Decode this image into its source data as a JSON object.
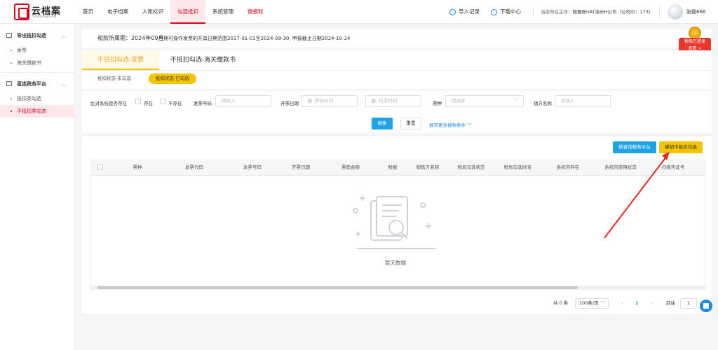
{
  "app": {
    "logo_text": "云档案",
    "logo_sub": "YUNDANGAN"
  },
  "nav": {
    "items": [
      {
        "label": "首页"
      },
      {
        "label": "电子档案"
      },
      {
        "label": "入账标识"
      },
      {
        "label": "勾选抵扣"
      },
      {
        "label": "系统管理"
      },
      {
        "label": "微报账"
      }
    ],
    "active_index": 3
  },
  "topbar": {
    "import_label": "导入记录",
    "download_label": "下载中心",
    "entity_label": "当前所在主体：",
    "entity_value": "微报账UAT演示H公司（公司ID：173）",
    "username": "张磊666"
  },
  "sidebar": {
    "groups": [
      {
        "label": "导出抵扣勾选",
        "items": [
          "发票",
          "海关缴款书"
        ]
      },
      {
        "label": "直连税务平台",
        "items": [
          "抵扣类勾选",
          "不抵扣类勾选"
        ]
      }
    ],
    "active_item": "不抵扣类勾选"
  },
  "header": {
    "tax_period": "税款所属期：2024年09月",
    "range_text": "当期可操作发票的开具日期范围2017-01-01至2024-09-30, 申报截止日期2024-10-24"
  },
  "badge": {
    "line1": "税局已登录",
    "line2": "查看 >"
  },
  "tabs": {
    "items": [
      "不抵扣勾选-发票",
      "不抵扣勾选-海关缴款书"
    ],
    "active_index": 0,
    "subtabs": [
      "抵扣状态-未勾选",
      "抵扣状态-已勾选"
    ],
    "active_subtab": 1
  },
  "filters": {
    "compare_label": "比对系统是否存在",
    "exists_label": "存在",
    "not_exists_label": "不存在",
    "invoice_no_label": "发票号码",
    "invoice_no_placeholder": "请输入",
    "issue_date_label": "开票日期",
    "start_placeholder": "开始时间",
    "end_placeholder": "结束时间",
    "date_sep": "-",
    "invoice_type_label": "票种",
    "invoice_type_placeholder": "请选择",
    "seller_label": "销方名称",
    "seller_placeholder": "请输入",
    "search_label": "搜索",
    "reset_label": "重置",
    "expand_label": "展开更多搜索条件"
  },
  "actions": {
    "new_platform_label": "新查询税务平台",
    "cancel_label": "撤销不抵扣勾选"
  },
  "table": {
    "columns": [
      "票种",
      "发票代码",
      "发票号码",
      "开票日期",
      "票面金额",
      "税额",
      "销售方名称",
      "税局勾选状态",
      "税局勾选时间",
      "系统内存在",
      "系统内使用状态",
      "扫描凭证号"
    ],
    "empty_text": "暂无数据"
  },
  "pagination": {
    "total_text": "共 0 条",
    "page_size": "100条/页",
    "current_page": "1",
    "goto_label": "前往",
    "goto_value": "1"
  }
}
